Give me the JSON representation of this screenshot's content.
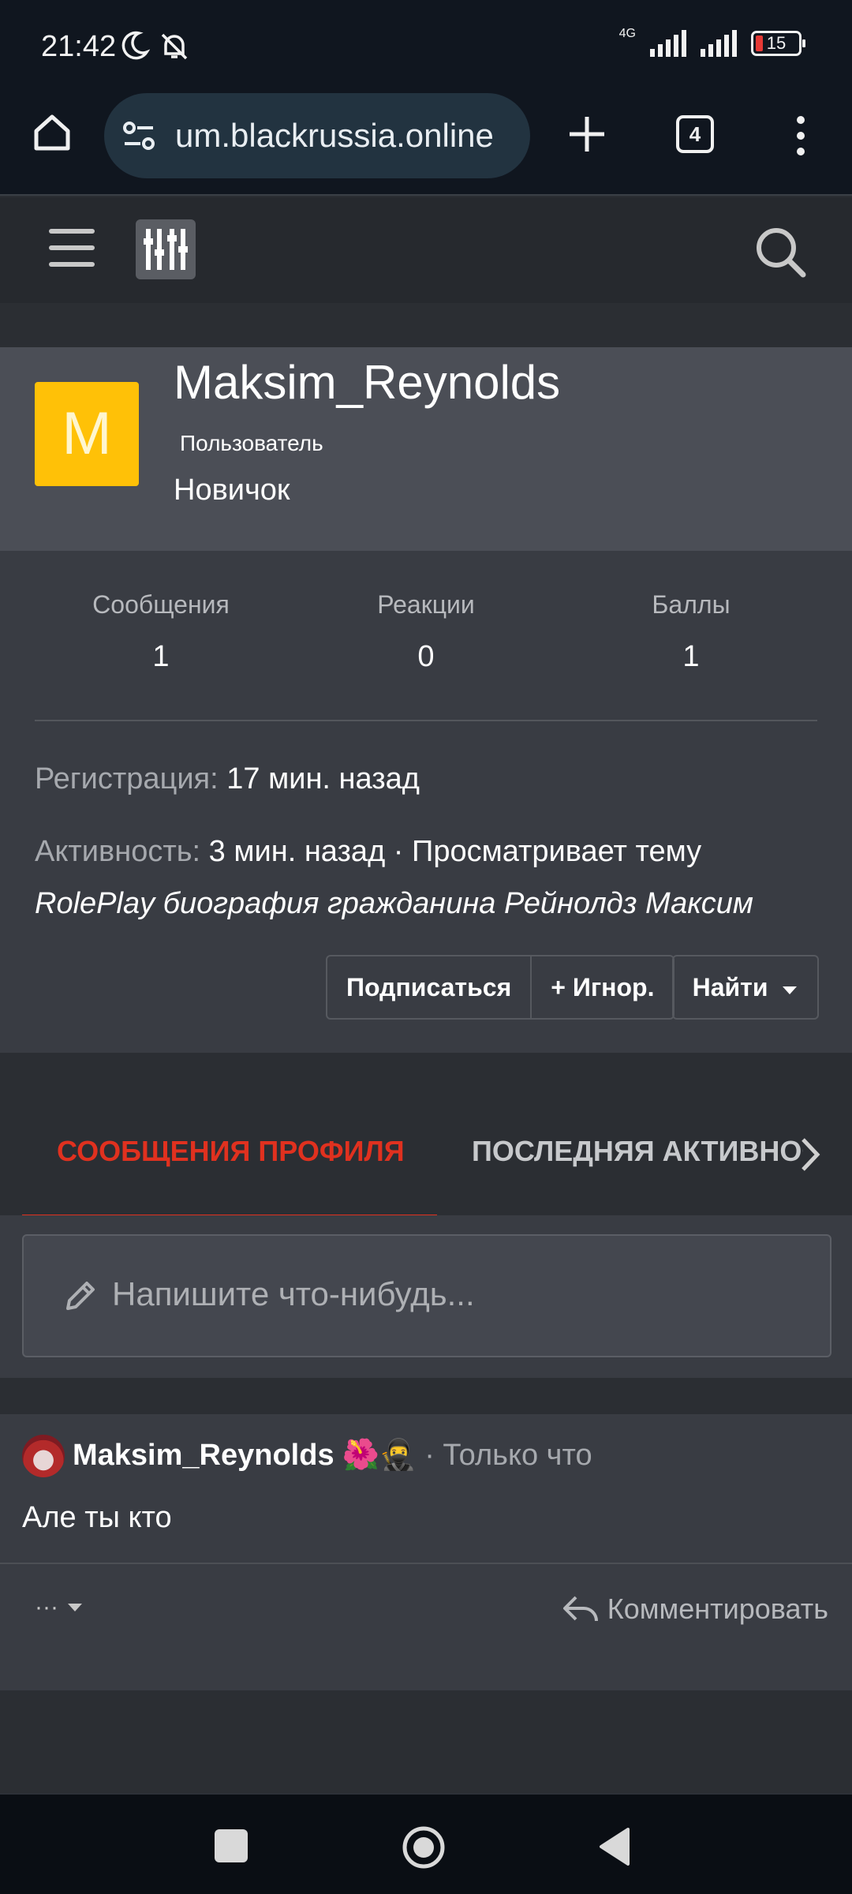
{
  "status_bar": {
    "time": "21:42",
    "network": "4G",
    "battery": "15",
    "icons": [
      "moon-icon",
      "bell-off-icon",
      "signal-icon",
      "battery-icon"
    ]
  },
  "browser": {
    "url": "um.blackrussia.online",
    "tab_count": "4",
    "icons": [
      "home-icon",
      "site-settings-icon",
      "new-tab-icon",
      "tabs-icon",
      "menu-icon"
    ]
  },
  "forum_nav": {
    "icons": [
      "hamburger-icon",
      "filter-sliders-icon",
      "search-icon"
    ]
  },
  "profile": {
    "avatar_letter": "M",
    "avatar_color": "#ffc107",
    "username": "Maksim_Reynolds",
    "role": "Пользователь",
    "rank": "Новичок",
    "stats": [
      {
        "label": "Сообщения",
        "value": "1"
      },
      {
        "label": "Реакции",
        "value": "0"
      },
      {
        "label": "Баллы",
        "value": "1"
      }
    ],
    "registration_label": "Регистрация:",
    "registration_value": "17 мин. назад",
    "activity_label": "Активность:",
    "activity_value": "3 мин. назад · Просматривает тему",
    "activity_thread": "RolePlay биография гражданина Рейнолдз Максим",
    "buttons": {
      "follow": "Подписаться",
      "ignore": "+ Игнор.",
      "find": "Найти"
    }
  },
  "tabs": {
    "active": "СООБЩЕНИЯ ПРОФИЛЯ",
    "next": "ПОСЛЕДНЯЯ АКТИВНОСТЬ",
    "accent_color": "#e0311f"
  },
  "compose": {
    "placeholder": "Напишите что-нибудь..."
  },
  "post": {
    "author": "Maksim_Reynolds",
    "author_emoji": "🌺🥷",
    "time": "· Только что",
    "text": "Але ты кто",
    "more_label": "···",
    "comment_label": "Комментировать"
  }
}
